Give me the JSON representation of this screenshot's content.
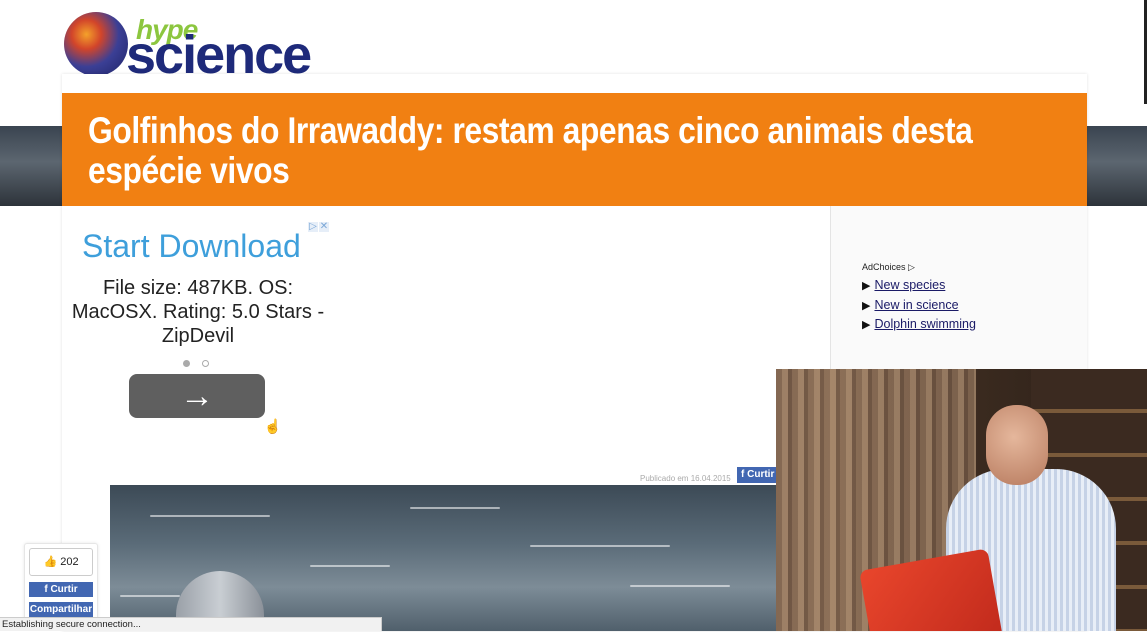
{
  "logo": {
    "hype": "hype",
    "science": "science"
  },
  "article": {
    "title": "Golfinhos do Irrawaddy: restam apenas cinco animais desta espécie vivos",
    "published": "Publicado em 16.04.2015"
  },
  "ad": {
    "headline": "Start Download",
    "description": "File size: 487KB. OS: MacOSX. Rating: 5.0 Stars - ZipDevil",
    "button_icon": "→",
    "carousel_active_index": 0,
    "carousel_count": 2
  },
  "sidebar": {
    "adchoices": "AdChoices",
    "links": [
      {
        "label": "New species"
      },
      {
        "label": "New in science"
      },
      {
        "label": "Dolphin swimming"
      }
    ]
  },
  "facebook": {
    "top_like_label": "Curtir",
    "like_count": "202",
    "like_label": "Curtir",
    "share_label": "Compartilhar"
  },
  "status_bar": {
    "text": "Establishing secure connection..."
  },
  "colors": {
    "banner": "#f18012",
    "ad_headline": "#3e9fdb",
    "facebook": "#4267b2"
  }
}
